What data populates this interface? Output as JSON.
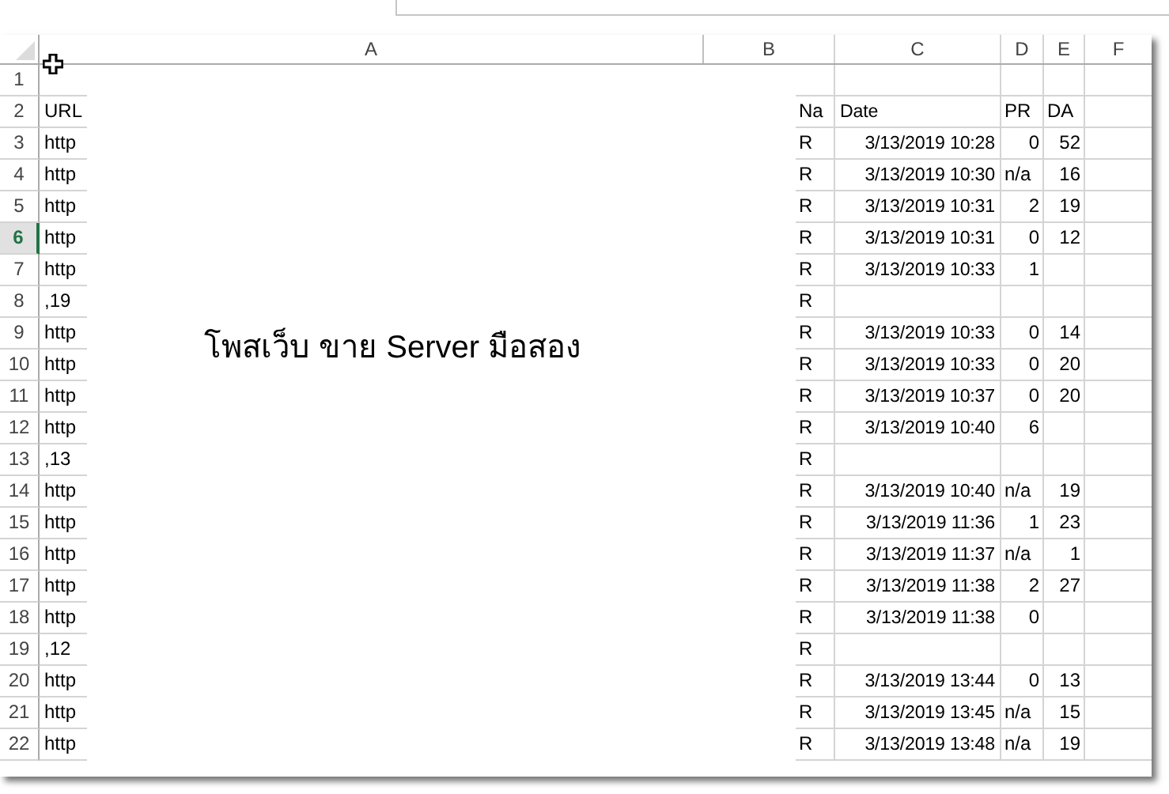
{
  "columns": [
    {
      "label": "A"
    },
    {
      "label": "B"
    },
    {
      "label": "C"
    },
    {
      "label": "D"
    },
    {
      "label": "E"
    },
    {
      "label": "F"
    }
  ],
  "overlay": {
    "text": "โพสเว็บ ขาย Server มือสอง"
  },
  "rows": [
    {
      "number": "1",
      "selected": false
    },
    {
      "number": "2",
      "selected": false,
      "a": "URL",
      "b": "Na",
      "c": "Date",
      "d": "PR",
      "e": "DA",
      "kind": "header"
    },
    {
      "number": "3",
      "selected": false,
      "a": "http",
      "b": "R",
      "c": "3/13/2019 10:28",
      "d": "0",
      "e": "52"
    },
    {
      "number": "4",
      "selected": false,
      "a": "http",
      "b": "R",
      "c": "3/13/2019 10:30",
      "d": "n/a",
      "e": "16"
    },
    {
      "number": "5",
      "selected": false,
      "a": "http",
      "b": "R",
      "c": "3/13/2019 10:31",
      "d": "2",
      "e": "19"
    },
    {
      "number": "6",
      "selected": true,
      "a": "http",
      "b": "R",
      "c": "3/13/2019 10:31",
      "d": "0",
      "e": "12"
    },
    {
      "number": "7",
      "selected": false,
      "a": "http",
      "b": "R",
      "c": "3/13/2019 10:33",
      "d": "1"
    },
    {
      "number": "8",
      "selected": false,
      "a": ",19",
      "b": "R"
    },
    {
      "number": "9",
      "selected": false,
      "a": "http",
      "b": "R",
      "c": "3/13/2019 10:33",
      "d": "0",
      "e": "14"
    },
    {
      "number": "10",
      "selected": false,
      "a": "http",
      "b": "R",
      "c": "3/13/2019 10:33",
      "d": "0",
      "e": "20"
    },
    {
      "number": "11",
      "selected": false,
      "a": "http",
      "b": "R",
      "c": "3/13/2019 10:37",
      "d": "0",
      "e": "20"
    },
    {
      "number": "12",
      "selected": false,
      "a": "http",
      "b": "R",
      "c": "3/13/2019 10:40",
      "d": "6"
    },
    {
      "number": "13",
      "selected": false,
      "a": ",13",
      "b": "R"
    },
    {
      "number": "14",
      "selected": false,
      "a": "http",
      "b": "R",
      "c": "3/13/2019 10:40",
      "d": "n/a",
      "e": "19"
    },
    {
      "number": "15",
      "selected": false,
      "a": "http",
      "b": "R",
      "c": "3/13/2019 11:36",
      "d": "1",
      "e": "23"
    },
    {
      "number": "16",
      "selected": false,
      "a": "http",
      "b": "R",
      "c": "3/13/2019 11:37",
      "d": "n/a",
      "e": "1"
    },
    {
      "number": "17",
      "selected": false,
      "a": "http",
      "b": "R",
      "c": "3/13/2019 11:38",
      "d": "2",
      "e": "27"
    },
    {
      "number": "18",
      "selected": false,
      "a": "http",
      "b": "R",
      "c": "3/13/2019 11:38",
      "d": "0"
    },
    {
      "number": "19",
      "selected": false,
      "a": ",12",
      "b": "R"
    },
    {
      "number": "20",
      "selected": false,
      "a": "http",
      "b": "R",
      "c": "3/13/2019 13:44",
      "d": "0",
      "e": "13"
    },
    {
      "number": "21",
      "selected": false,
      "a": "http",
      "b": "R",
      "c": "3/13/2019 13:45",
      "d": "n/a",
      "e": "15"
    },
    {
      "number": "22",
      "selected": false,
      "a": "http",
      "b": "R",
      "c": "3/13/2019 13:48",
      "d": "n/a",
      "e": "19"
    }
  ]
}
